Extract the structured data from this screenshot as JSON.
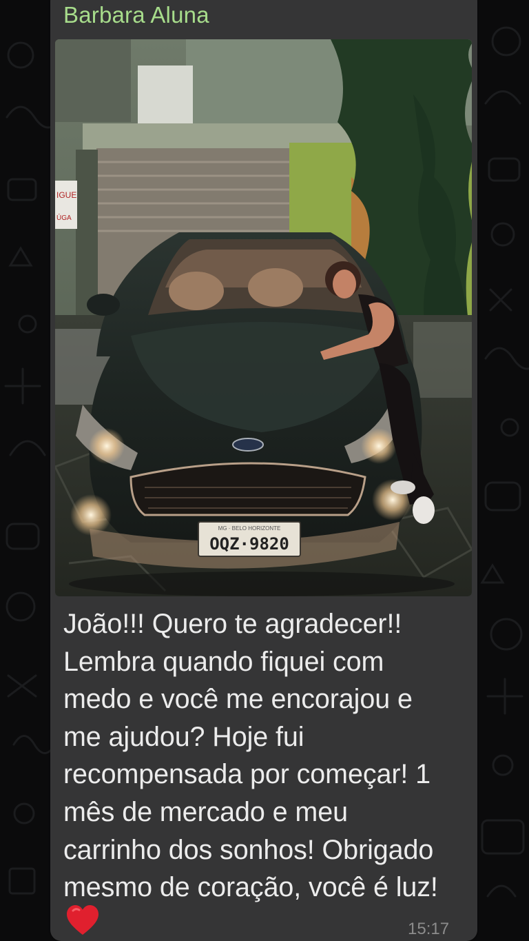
{
  "chat": {
    "sender_name": "Barbara Aluna",
    "photo": {
      "license_plate": "OQZ·9820",
      "plate_city": "MG · BELO HORIZONTE",
      "sign_text_1": "IGUE",
      "sign_text_2": "ÚGA"
    },
    "message_lines": [
      "João!!! Quero te agradecer!!",
      "Lembra quando fiquei com",
      "medo e você me encorajou e",
      "me ajudou? Hoje fui",
      "recompensada por começar! 1",
      "mês de mercado e meu",
      "carrinho dos sonhos! Obrigado",
      "mesmo de coração, você é luz!"
    ],
    "emoji": "red-heart",
    "time": "15:17"
  },
  "colors": {
    "background": "#0b0b0c",
    "bubble": "#353536",
    "sender_name": "#a7dc8b",
    "message_text": "#ececec",
    "timestamp": "#8c8c8c",
    "heart": "#e0202e"
  }
}
